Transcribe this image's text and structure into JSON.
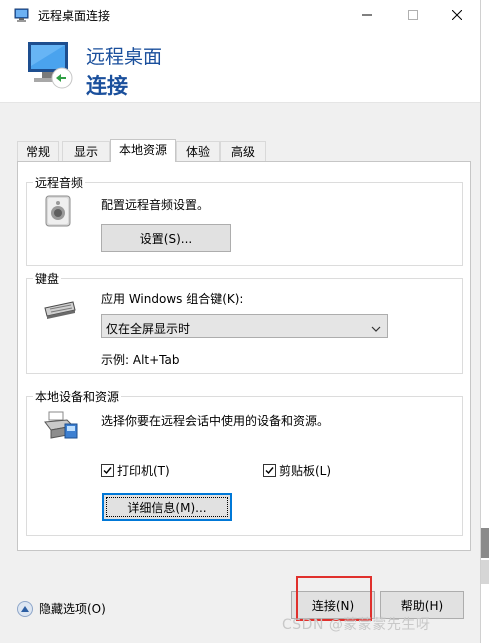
{
  "window": {
    "title": "远程桌面连接"
  },
  "banner": {
    "line1": "远程桌面",
    "line2": "连接"
  },
  "tabs": [
    {
      "label": "常规"
    },
    {
      "label": "显示"
    },
    {
      "label": "本地资源"
    },
    {
      "label": "体验"
    },
    {
      "label": "高级"
    }
  ],
  "audio": {
    "legend": "远程音频",
    "description": "配置远程音频设置。",
    "settings_button": "设置(S)..."
  },
  "keyboard": {
    "legend": "键盘",
    "label": "应用 Windows 组合键(K):",
    "selected": "仅在全屏显示时",
    "example": "示例: Alt+Tab"
  },
  "devices": {
    "legend": "本地设备和资源",
    "description": "选择你要在远程会话中使用的设备和资源。",
    "printer_label": "打印机(T)",
    "printer_checked": true,
    "clipboard_label": "剪贴板(L)",
    "clipboard_checked": true,
    "details_button": "详细信息(M)..."
  },
  "footer": {
    "hide_options": "隐藏选项(O)",
    "connect_button": "连接(N)",
    "help_button": "帮助(H)"
  },
  "watermark": "CSDN @蒙蒙蒙先生呀",
  "colors": {
    "banner_text": "#1a4f9c",
    "focus_border": "#0078d7",
    "highlight_outline": "#e0302c"
  }
}
